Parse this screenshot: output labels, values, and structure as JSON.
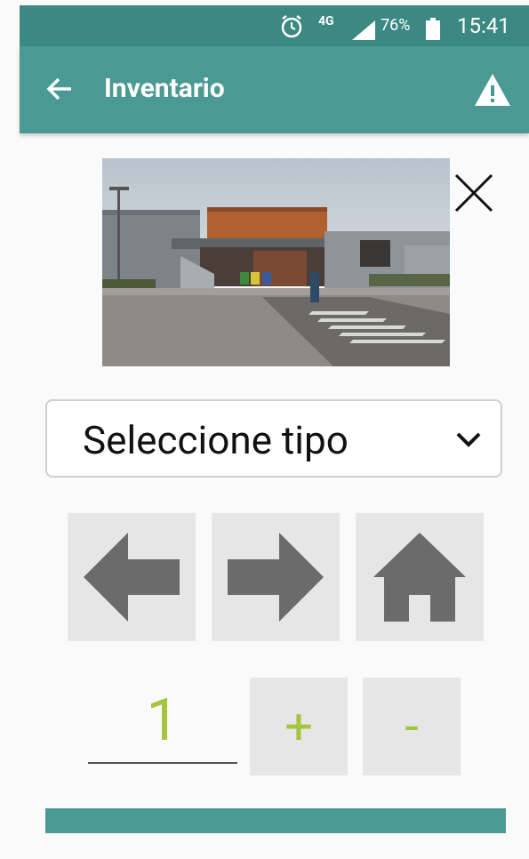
{
  "status_bar": {
    "network": "4G",
    "battery_percent": "76%",
    "time": "15:41",
    "icons": [
      "alarm-icon",
      "signal-icon",
      "battery-icon"
    ]
  },
  "app_bar": {
    "title": "Inventario",
    "back_icon": "arrow-left-icon",
    "action_icon": "warning-icon"
  },
  "photo": {
    "description_icon": "building-photo",
    "close_icon": "close-icon"
  },
  "type_select": {
    "selected": "Seleccione tipo",
    "icon": "chevron-down-icon"
  },
  "navigation": {
    "prev_icon": "arrow-left-icon",
    "next_icon": "arrow-right-icon",
    "home_icon": "home-icon"
  },
  "quantity": {
    "value": "1",
    "plus_label": "+",
    "minus_label": "-"
  },
  "colors": {
    "status_bar": "#3b8982",
    "app_bar": "#4a9a93",
    "accent": "#a5c53c",
    "button_bg": "#e6e6e6",
    "icon_gray": "#6b6b6b"
  }
}
